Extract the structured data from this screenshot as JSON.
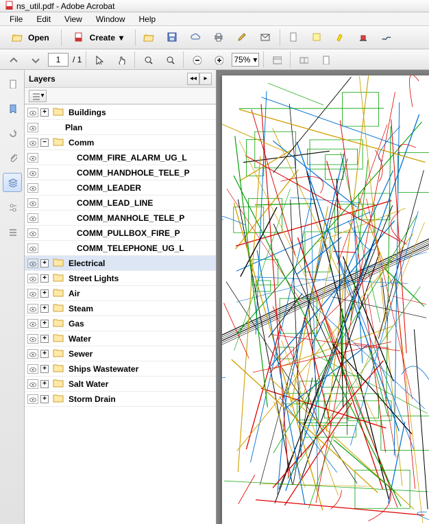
{
  "window": {
    "title": "ns_util.pdf - Adobe Acrobat"
  },
  "menubar": {
    "items": [
      "File",
      "Edit",
      "View",
      "Window",
      "Help"
    ]
  },
  "toolbar1": {
    "open_label": "Open",
    "create_label": "Create"
  },
  "toolbar2": {
    "page_value": "1",
    "page_total": "/ 1",
    "zoom_value": "75%"
  },
  "panel": {
    "title": "Layers"
  },
  "layers": [
    {
      "name": "Buildings",
      "expanded": "+",
      "depth": 0,
      "bold": true,
      "folder": true
    },
    {
      "name": "Plan",
      "expanded": "",
      "depth": 0,
      "bold": true,
      "folder": false
    },
    {
      "name": "Comm",
      "expanded": "−",
      "depth": 0,
      "bold": true,
      "folder": true
    },
    {
      "name": "COMM_FIRE_ALARM_UG_L",
      "expanded": "",
      "depth": 1,
      "bold": true,
      "folder": false
    },
    {
      "name": "COMM_HANDHOLE_TELE_P",
      "expanded": "",
      "depth": 1,
      "bold": true,
      "folder": false
    },
    {
      "name": "COMM_LEADER",
      "expanded": "",
      "depth": 1,
      "bold": true,
      "folder": false
    },
    {
      "name": "COMM_LEAD_LINE",
      "expanded": "",
      "depth": 1,
      "bold": true,
      "folder": false
    },
    {
      "name": "COMM_MANHOLE_TELE_P",
      "expanded": "",
      "depth": 1,
      "bold": true,
      "folder": false
    },
    {
      "name": "COMM_PULLBOX_FIRE_P",
      "expanded": "",
      "depth": 1,
      "bold": true,
      "folder": false
    },
    {
      "name": "COMM_TELEPHONE_UG_L",
      "expanded": "",
      "depth": 1,
      "bold": true,
      "folder": false
    },
    {
      "name": "Electrical",
      "expanded": "+",
      "depth": 0,
      "bold": true,
      "folder": true,
      "selected": true
    },
    {
      "name": "Street Lights",
      "expanded": "+",
      "depth": 0,
      "bold": true,
      "folder": true
    },
    {
      "name": "Air",
      "expanded": "+",
      "depth": 0,
      "bold": true,
      "folder": true
    },
    {
      "name": "Steam",
      "expanded": "+",
      "depth": 0,
      "bold": true,
      "folder": true
    },
    {
      "name": "Gas",
      "expanded": "+",
      "depth": 0,
      "bold": true,
      "folder": true
    },
    {
      "name": "Water",
      "expanded": "+",
      "depth": 0,
      "bold": true,
      "folder": true
    },
    {
      "name": "Sewer",
      "expanded": "+",
      "depth": 0,
      "bold": true,
      "folder": true
    },
    {
      "name": "Ships Wastewater",
      "expanded": "+",
      "depth": 0,
      "bold": true,
      "folder": true
    },
    {
      "name": "Salt Water",
      "expanded": "+",
      "depth": 0,
      "bold": true,
      "folder": true
    },
    {
      "name": "Storm Drain",
      "expanded": "+",
      "depth": 0,
      "bold": true,
      "folder": true
    }
  ]
}
